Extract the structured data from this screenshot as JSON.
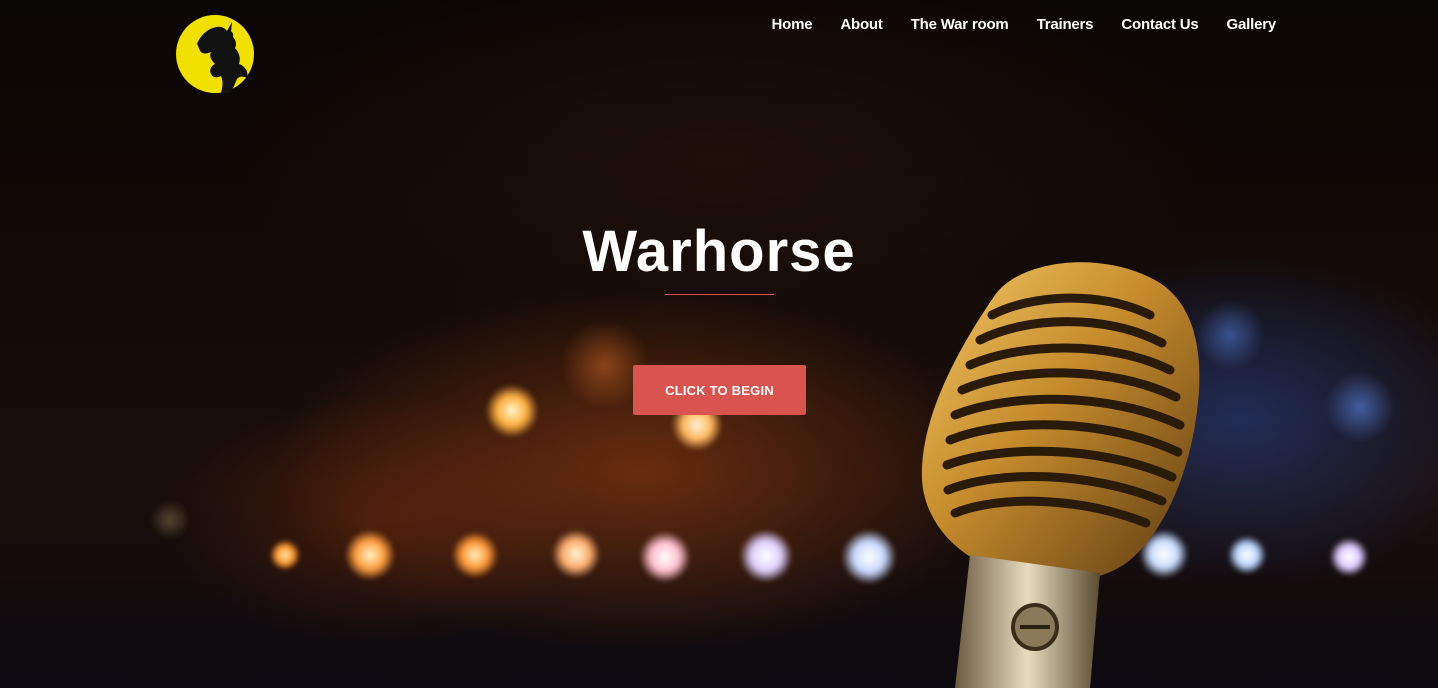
{
  "header": {
    "logo_name": "warhorse-logo",
    "nav": [
      {
        "label": "Home"
      },
      {
        "label": "About"
      },
      {
        "label": "The War room"
      },
      {
        "label": "Trainers"
      },
      {
        "label": "Contact Us"
      },
      {
        "label": "Gallery"
      }
    ]
  },
  "hero": {
    "title": "Warhorse",
    "cta_label": "CLICK TO BEGIN",
    "background_image": "concert-stage-bokeh-with-vintage-microphone"
  },
  "colors": {
    "accent": "#d9534f",
    "logo_yellow": "#f2e000",
    "text": "#ffffff"
  }
}
